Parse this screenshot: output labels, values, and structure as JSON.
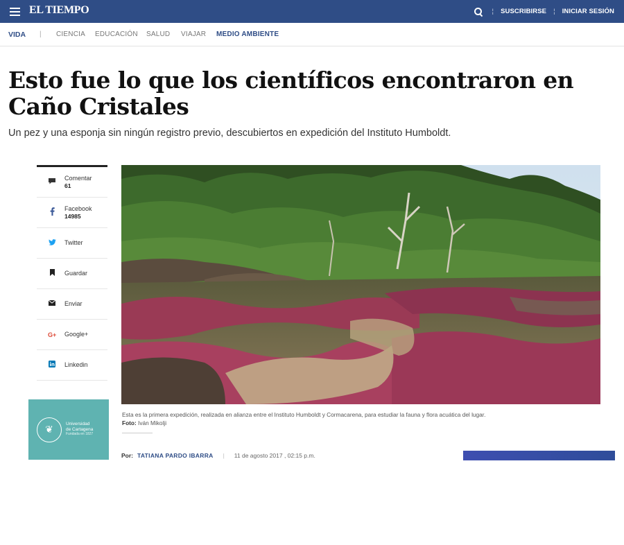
{
  "topbar": {
    "logo": "EL TIEMPO",
    "subscribe_label": "SUSCRIBIRSE",
    "login_label": "INICIAR SESIÓN",
    "separator": "¦"
  },
  "secnav": {
    "section": "VIDA",
    "bar": "|",
    "items": [
      "CIENCIA",
      "EDUCACIÓN",
      "SALUD",
      "VIAJAR",
      "MEDIO AMBIENTE"
    ]
  },
  "article": {
    "title": "Esto fue lo que los científicos encontraron en Caño Cristales",
    "subtitle": "Un pez y una esponja sin ningún registro previo, descubiertos en expedición del Instituto Humboldt.",
    "caption": "Esta es la primera expedición, realizada en alianza entre el Instituto Humboldt y Cormacarena, para estudiar la fauna y flora acuática del lugar.",
    "photo_credit_label": "Foto:",
    "photo_credit": "Iván Mikolji",
    "byline_prefix": "Por:",
    "author": "TATIANA PARDO IBARRA",
    "date": "11 de agosto 2017 , 02:15 p.m."
  },
  "share": [
    {
      "label": "Comentar",
      "count": "61",
      "icon": "comment-icon"
    },
    {
      "label": "Facebook",
      "count": "14985",
      "icon": "facebook-icon"
    },
    {
      "label": "Twitter",
      "count": "",
      "icon": "twitter-icon"
    },
    {
      "label": "Guardar",
      "count": "",
      "icon": "bookmark-icon"
    },
    {
      "label": "Enviar",
      "count": "",
      "icon": "email-icon"
    },
    {
      "label": "Google+",
      "count": "",
      "icon": "google-plus-icon"
    },
    {
      "label": "Linkedin",
      "count": "",
      "icon": "linkedin-icon"
    }
  ],
  "ad": {
    "line1": "Universidad",
    "line2": "de Cartagena",
    "line3": "Fundada en 1827"
  },
  "colors": {
    "brand": "#2f4d86",
    "ad_bg": "#5fb3b1"
  }
}
